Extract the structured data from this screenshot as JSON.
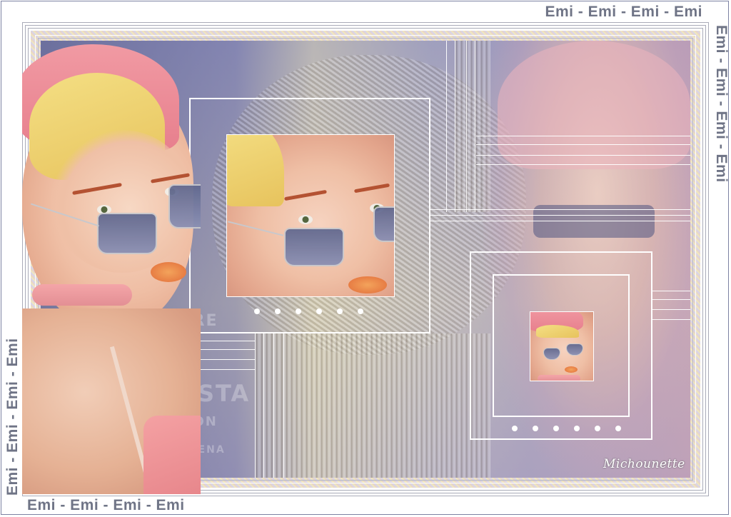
{
  "watermark": {
    "top": "Emi - Emi - Emi - Emi",
    "right": "Emi - Emi - Emi - Emi",
    "left": "Emi - Emi - Emi - Emi",
    "bottom": "Emi - Emi - Emi - Emi"
  },
  "signature": "Michounette",
  "background_text": {
    "line1": "CHIFF GRE",
    "line2": "GI POSTA",
    "line3": "R AVION",
    "line4": "© BENA"
  },
  "colors": {
    "pink_hat": "#e77f8d",
    "lavender": "#8c8ebd",
    "cream": "#e8d8a8",
    "watermark_grey": "#6f7486"
  },
  "decor": {
    "dots_large_frame": 6,
    "dots_small_frame": 6
  }
}
